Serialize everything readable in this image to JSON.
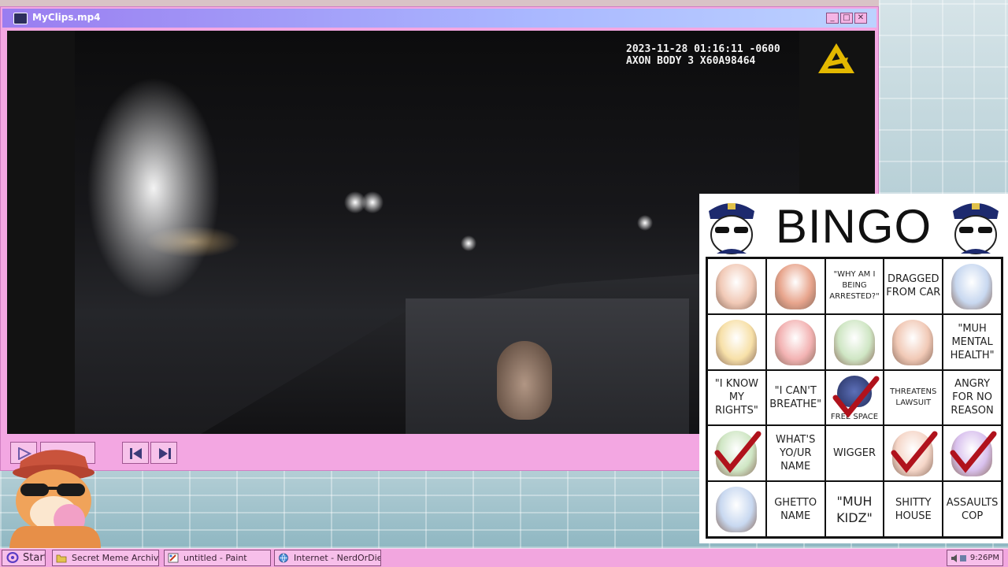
{
  "window": {
    "title": "MyClips.mp4",
    "minimize": "_",
    "maximize": "□",
    "close": "✕"
  },
  "video": {
    "timestamp": "2023-11-28 01:16:11 -0600",
    "device": "AXON BODY 3 X60A98464"
  },
  "controls": {
    "play_icon": "play-icon",
    "stop_icon": "stop-icon",
    "prev_icon": "skip-back-icon",
    "next_icon": "skip-forward-icon"
  },
  "bingo": {
    "title": "BINGO",
    "cells": [
      {
        "text": "",
        "type": "image",
        "icon": "cat-sticker-icon",
        "checked": false
      },
      {
        "text": "",
        "type": "image",
        "icon": "crying-woman-photo",
        "checked": false
      },
      {
        "text": "\"WHY AM I BEING ARRESTED?\"",
        "type": "text",
        "size": "small",
        "checked": false
      },
      {
        "text": "DRAGGED FROM CAR",
        "type": "text",
        "size": "t",
        "checked": false
      },
      {
        "text": "",
        "type": "image",
        "icon": "doodle-sketch-icon",
        "checked": false
      },
      {
        "text": "",
        "type": "image",
        "icon": "wounded-character-icon",
        "checked": false
      },
      {
        "text": "",
        "type": "image",
        "icon": "driving-cat-icon",
        "checked": false
      },
      {
        "text": "",
        "type": "image",
        "icon": "cartoon-girl-icon",
        "checked": false
      },
      {
        "text": "",
        "type": "image",
        "icon": "calico-cat-icon",
        "checked": false
      },
      {
        "text": "\"MUH MENTAL HEALTH\"",
        "type": "text",
        "size": "t",
        "checked": false
      },
      {
        "text": "\"I KNOW MY RIGHTS\"",
        "type": "text",
        "size": "t",
        "checked": false
      },
      {
        "text": "\"I CAN'T BREATHE\"",
        "type": "text",
        "size": "t",
        "checked": false
      },
      {
        "text": "FREE SPACE",
        "type": "free",
        "icon": "police-badge-icon",
        "checked": true
      },
      {
        "text": "THREATENS LAWSUIT",
        "type": "text",
        "size": "small",
        "checked": false
      },
      {
        "text": "ANGRY FOR NO REASON",
        "type": "text",
        "size": "t",
        "checked": false
      },
      {
        "text": "",
        "type": "image",
        "icon": "clown-girl-icon",
        "checked": true
      },
      {
        "text": "WHAT'S YO/UR NAME",
        "type": "text",
        "size": "t",
        "checked": false
      },
      {
        "text": "WIGGER",
        "type": "text",
        "size": "t",
        "checked": false
      },
      {
        "text": "",
        "type": "image",
        "icon": "angry-cat-icon",
        "checked": true
      },
      {
        "text": "",
        "type": "image",
        "icon": "shouting-cat-icon",
        "checked": true
      },
      {
        "text": "",
        "type": "image",
        "icon": "fat-cat-icon",
        "checked": false
      },
      {
        "text": "GHETTO NAME",
        "type": "text",
        "size": "t",
        "checked": false
      },
      {
        "text": "\"MUH KIDZ\"",
        "type": "text",
        "size": "big",
        "checked": false
      },
      {
        "text": "SHITTY HOUSE",
        "type": "text",
        "size": "t",
        "checked": false
      },
      {
        "text": "ASSAULTS COP",
        "type": "text",
        "size": "t",
        "checked": false
      }
    ]
  },
  "taskbar": {
    "start": "Start",
    "items": [
      {
        "label": "Secret Meme Archive",
        "icon": "folder-icon"
      },
      {
        "label": "untitled - Paint",
        "icon": "paint-icon"
      },
      {
        "label": "Internet - NerdOrDie.com",
        "icon": "globe-icon"
      }
    ],
    "clock": "9:26PM"
  },
  "colors": {
    "window_frame": "#f3a7e2",
    "titlebar_start": "#9a7df0",
    "titlebar_end": "#bcd2ff",
    "check_red": "#b0121c",
    "taskbar": "#f2a6df"
  }
}
